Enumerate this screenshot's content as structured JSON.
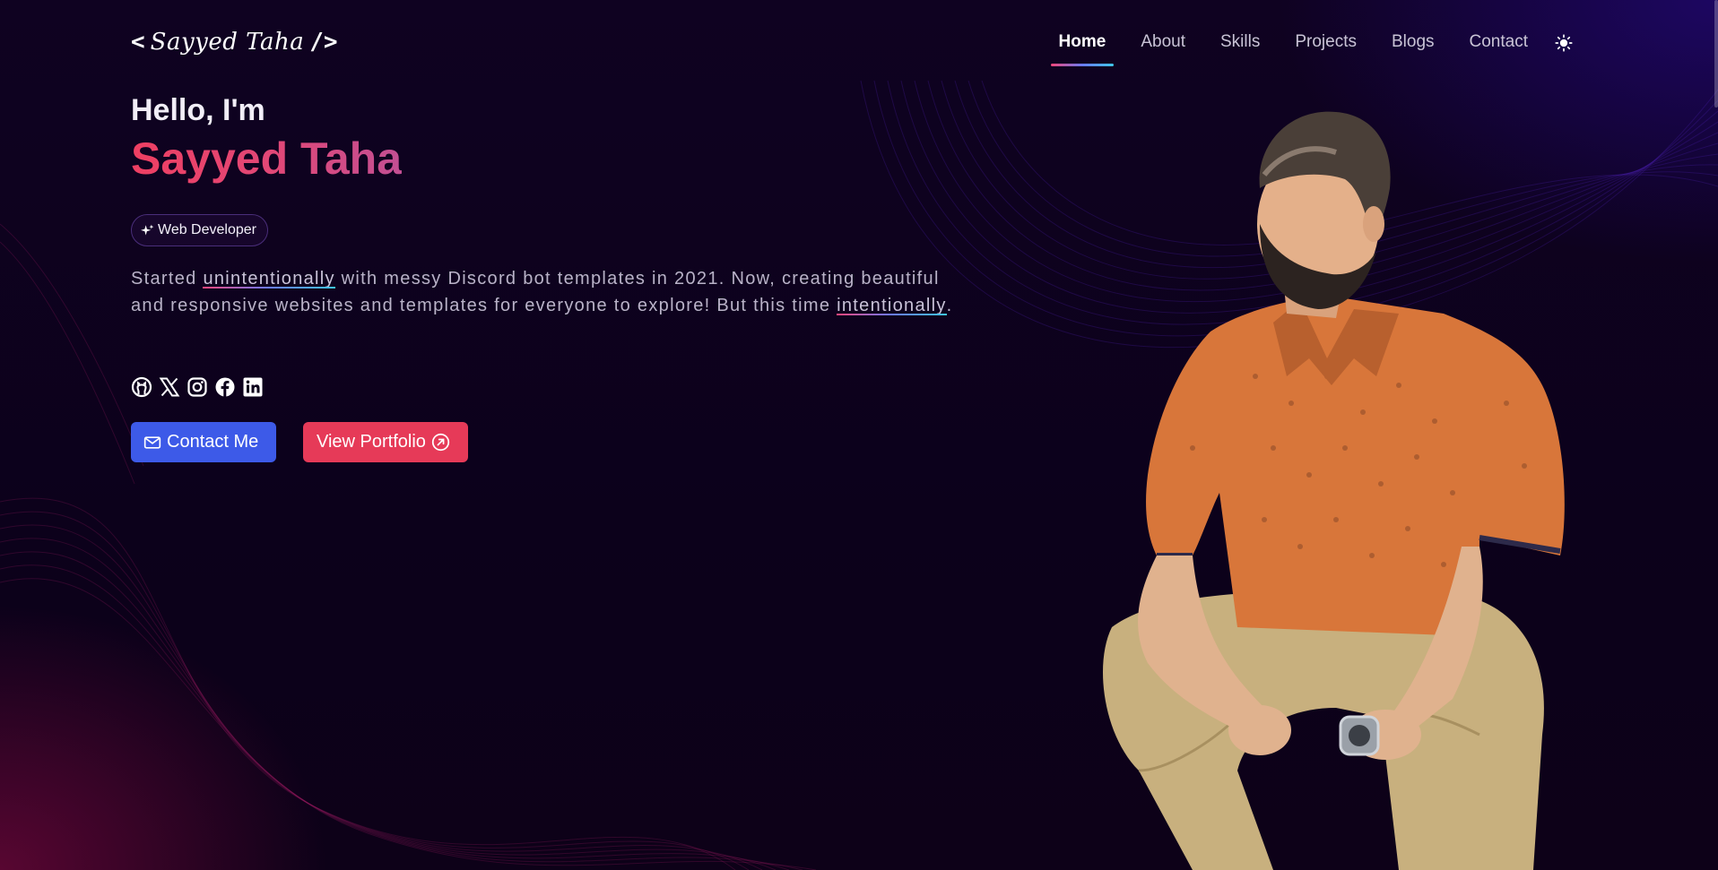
{
  "nav": {
    "logo_left": "<",
    "logo_text": "Sayyed Taha",
    "logo_right": "/>",
    "items": [
      {
        "label": "Home",
        "active": true
      },
      {
        "label": "About",
        "active": false
      },
      {
        "label": "Skills",
        "active": false
      },
      {
        "label": "Projects",
        "active": false
      },
      {
        "label": "Blogs",
        "active": false
      },
      {
        "label": "Contact",
        "active": false
      }
    ],
    "theme_icon": "sun-icon"
  },
  "hero": {
    "greeting": "Hello, I'm",
    "name": "Sayyed Taha",
    "badge": "Web Developer",
    "badge_icon": "sparkles-icon",
    "desc_part1": "Started ",
    "desc_emph1": "unintentionally",
    "desc_part2": " with messy Discord bot templates in 2021. Now, creating beautiful and responsive websites and templates for everyone to explore! But this time ",
    "desc_emph2": "intentionally",
    "desc_part3": ".",
    "socials": [
      "github-icon",
      "x-icon",
      "instagram-icon",
      "facebook-icon",
      "linkedin-icon"
    ],
    "contact_label": "Contact Me",
    "portfolio_label": "View Portfolio"
  },
  "colors": {
    "background": "#0c011b",
    "accent_pink": "#e63a58",
    "accent_blue": "#3d5ae8",
    "name_gradient_start": "#ee3f62",
    "name_gradient_end": "#c24f93"
  }
}
